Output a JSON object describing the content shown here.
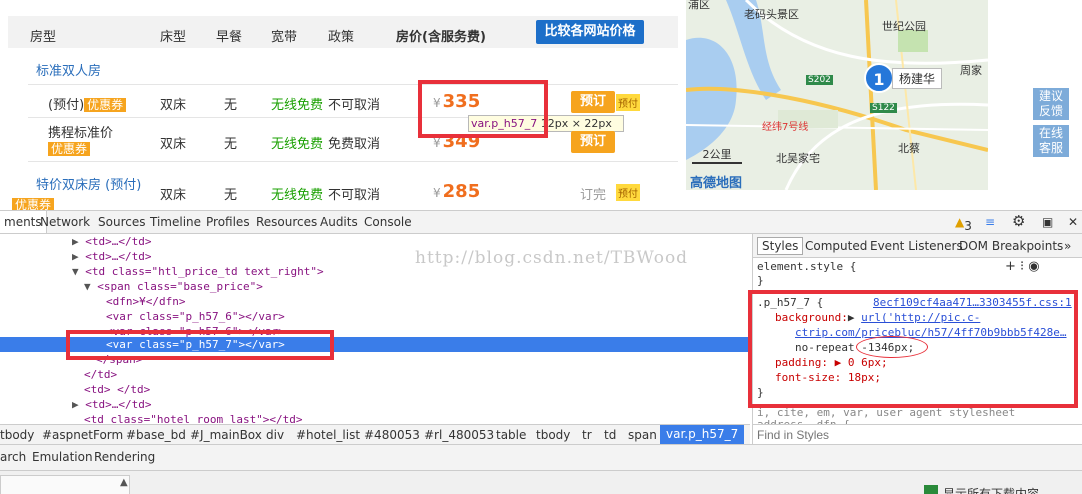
{
  "table_header": {
    "room_type": "房型",
    "bed": "床型",
    "breakfast": "早餐",
    "broadband": "宽带",
    "policy": "政策",
    "price": "房价(含服务费)",
    "compare_button": "比较各网站价格"
  },
  "category": "标准双人房",
  "rows": [
    {
      "name": "(预付)",
      "coupon": "优惠券",
      "bed": "双床",
      "breakfast": "无",
      "wifi": "无线免费",
      "policy": "不可取消",
      "price_prefix": "¥",
      "price": "335",
      "book": "预订",
      "badge": "预付"
    },
    {
      "name": "携程标准价",
      "coupon": "优惠券",
      "bed": "双床",
      "breakfast": "无",
      "wifi": "无线免费",
      "policy": "免费取消",
      "price_prefix": "¥",
      "price": "349",
      "book": "预订"
    },
    {
      "name": "特价双床房 (预付)",
      "coupon": "优惠券",
      "bed": "双床",
      "breakfast": "无",
      "wifi": "无线免费",
      "policy": "不可取消",
      "price_prefix": "¥",
      "price": "285",
      "book": "订完",
      "badge": "预付"
    }
  ],
  "tooltip": {
    "selector": "var.p_h57_7",
    "size": "12px × 22px"
  },
  "map": {
    "labels": [
      "浦区",
      "老码头景区",
      "世纪公园",
      "周家",
      "北蔡",
      "北吴家宅",
      "经纬7号线"
    ],
    "road_badges": [
      "S202",
      "S122"
    ],
    "pin_number": "1",
    "pin_label": "杨建华",
    "scale": "2公里",
    "logo": "高德地图"
  },
  "side_buttons": [
    {
      "line1": "建议",
      "line2": "反馈"
    },
    {
      "line1": "在线",
      "line2": "客服"
    }
  ],
  "devtools": {
    "tabs": [
      "ments",
      "Network",
      "Sources",
      "Timeline",
      "Profiles",
      "Resources",
      "Audits",
      "Console"
    ],
    "warning_count": "3",
    "code_lines": [
      {
        "pre": "▶ ",
        "html": "<td>…</td>"
      },
      {
        "pre": "▶ ",
        "html": "<td>…</td>"
      },
      {
        "pre": "▼ ",
        "html": "<td class=\"htl_price_td text_right\">"
      },
      {
        "pre": "▼ ",
        "html": "<span class=\"base_price\">"
      },
      {
        "pre": "",
        "html": "<dfn>¥</dfn>"
      },
      {
        "pre": "",
        "html": "<var class=\"p_h57_6\"></var>"
      },
      {
        "pre": "",
        "html": "<var class=\"p_h57_6\"></var>"
      },
      {
        "pre": "",
        "html": "<var class=\"p_h57_7\"></var>"
      },
      {
        "pre": "",
        "html": "</span>"
      },
      {
        "pre": "",
        "html": "</td>"
      },
      {
        "pre": "",
        "html": "<td> </td>"
      },
      {
        "pre": "▶ ",
        "html": "<td>…</td>"
      },
      {
        "pre": "",
        "html": "<td class=\"hotel room last\"></td>"
      }
    ],
    "watermark": "http://blog.csdn.net/TBWood",
    "style_tabs": [
      "Styles",
      "Computed",
      "Event Listeners",
      "DOM Breakpoints"
    ],
    "element_style": "element.style {",
    "rule": {
      "selector": ".p_h57_7 {",
      "source": "8ecf109cf4aa471…3303455f.css:1",
      "bg_prop": "background:",
      "bg_url1": "url('http://pic.c-",
      "bg_url2": "ctrip.com/pricebluc/h57/4ff70b9bbb5f428e…",
      "bg_repeat": "no-repeat",
      "bg_pos": "-1346px;",
      "padding": "padding: ▶ 0 6px;",
      "font_size": "font-size: 18px;",
      "close": "}"
    },
    "ua_line": "i, cite, em, var,          user agent stylesheet",
    "ua_line2": "address, dfn {",
    "breadcrumbs": [
      "tbody",
      "#aspnetForm",
      "#base_bd",
      "#J_mainBox",
      "div",
      "#hotel_list",
      "#480053",
      "#rl_480053",
      "table",
      "tbody",
      "tr",
      "td",
      "span",
      "var.p_h57_7"
    ],
    "find_placeholder": "Find in Styles",
    "drawer_tabs": [
      "arch",
      "Emulation",
      "Rendering"
    ],
    "download_text": "显示所有下载内容"
  }
}
